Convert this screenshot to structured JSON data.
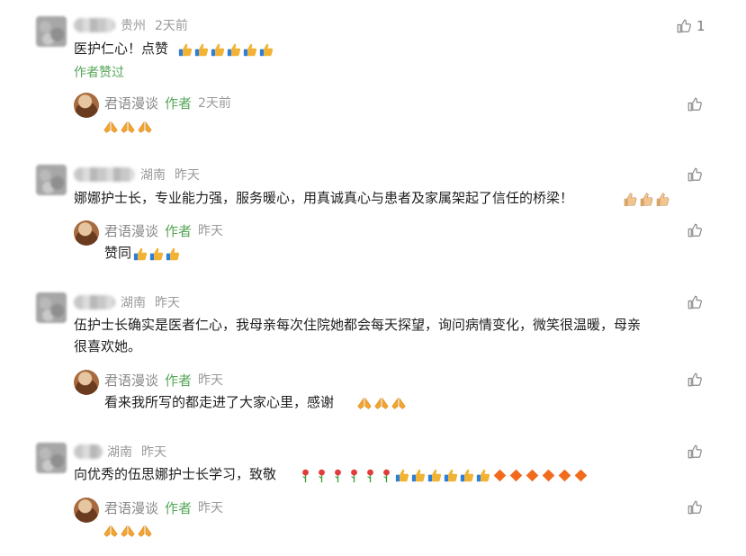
{
  "comments": [
    {
      "location": "贵州",
      "time": "2天前",
      "text": "医护仁心！点赞",
      "emoji_suffix": [
        "thumbs-up-icon",
        "thumbs-up-icon",
        "thumbs-up-icon",
        "thumbs-up-icon",
        "thumbs-up-icon",
        "thumbs-up-icon"
      ],
      "likes": "1",
      "author_liked": "作者赞过",
      "reply": {
        "name": "君语漫谈",
        "tag": "作者",
        "time": "2天前",
        "text": "",
        "emoji_suffix": [
          "pray-icon",
          "pray-icon",
          "pray-icon"
        ]
      }
    },
    {
      "location": "湖南",
      "time": "昨天",
      "text": "娜娜护士长，专业能力强，服务暖心，用真诚真心与患者及家属架起了信任的桥梁！",
      "emoji_suffix": [
        "thumbs-up-tan-icon",
        "thumbs-up-tan-icon",
        "thumbs-up-tan-icon"
      ],
      "reply": {
        "name": "君语漫谈",
        "tag": "作者",
        "time": "昨天",
        "text": "赞同",
        "emoji_suffix": [
          "thumbs-up-icon",
          "thumbs-up-icon",
          "thumbs-up-icon"
        ]
      }
    },
    {
      "location": "湖南",
      "time": "昨天",
      "text_line1": "伍护士长确实是医者仁心，我母亲每次住院她都会每天探望，询问病情变化，微笑很温暖，母亲",
      "text_line2": "很喜欢她。",
      "reply": {
        "name": "君语漫谈",
        "tag": "作者",
        "time": "昨天",
        "text": "看来我所写的都走进了大家心里，感谢",
        "emoji_suffix": [
          "pray-icon",
          "pray-icon",
          "pray-icon"
        ]
      }
    },
    {
      "location": "湖南",
      "time": "昨天",
      "text": "向优秀的伍思娜护士长学习，致敬",
      "emoji_suffix": [
        "rose-icon",
        "rose-icon",
        "rose-icon",
        "rose-icon",
        "rose-icon",
        "rose-icon",
        "thumbs-up-icon",
        "thumbs-up-icon",
        "thumbs-up-icon",
        "thumbs-up-icon",
        "thumbs-up-icon",
        "thumbs-up-icon",
        "orange-diamond-icon",
        "orange-diamond-icon",
        "orange-diamond-icon",
        "orange-diamond-icon",
        "orange-diamond-icon",
        "orange-diamond-icon"
      ],
      "reply": {
        "name": "君语漫谈",
        "tag": "作者",
        "time": "昨天",
        "text": "",
        "emoji_suffix": [
          "pray-icon",
          "pray-icon",
          "pray-icon"
        ]
      }
    }
  ],
  "colors": {
    "author_green": "#57a75a",
    "meta_gray": "#9a9a9a",
    "text": "#1f1f1f"
  }
}
